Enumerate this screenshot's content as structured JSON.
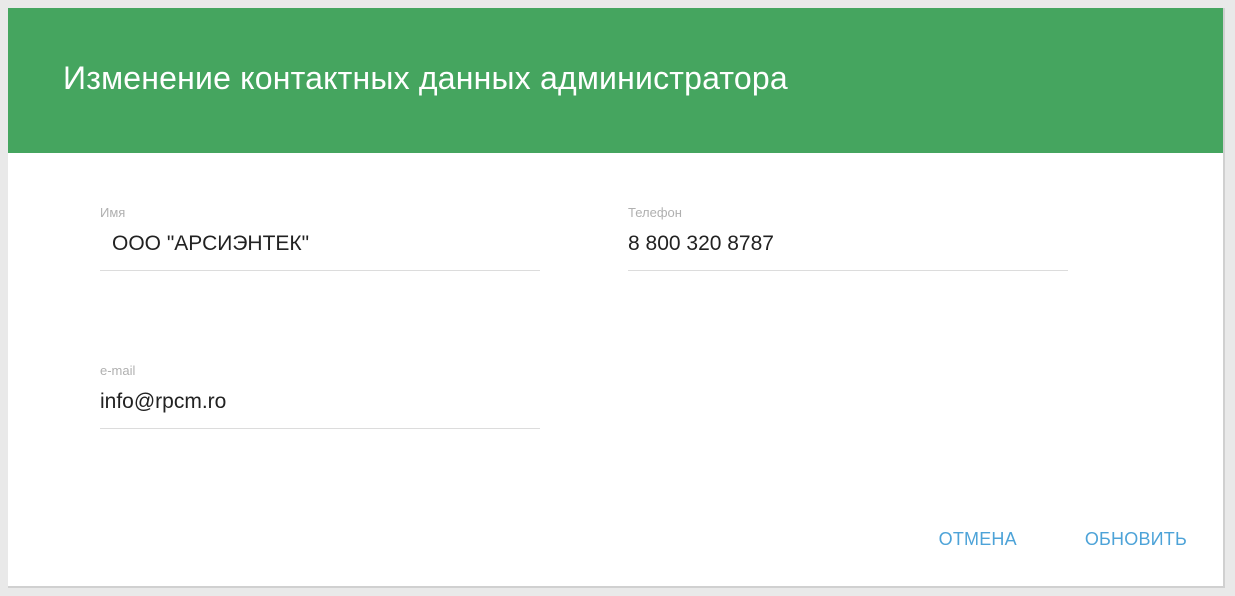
{
  "dialog": {
    "title": "Изменение контактных данных администратора",
    "header_color": "#45a55f",
    "accent_color": "#4da3d8"
  },
  "fields": {
    "name": {
      "label": "Имя",
      "value": "ООО \"АРСИЭНТЕК\""
    },
    "phone": {
      "label": "Телефон",
      "value": "8 800 320 8787"
    },
    "email": {
      "label": "e-mail",
      "value": "info@rpcm.ro"
    }
  },
  "actions": {
    "cancel_label": "ОТМЕНА",
    "update_label": "ОБНОВИТЬ"
  }
}
